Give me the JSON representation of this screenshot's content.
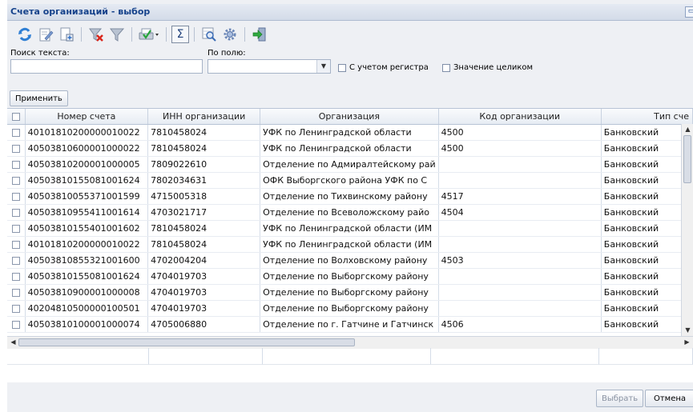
{
  "window": {
    "title": "Счета организаций - выбор"
  },
  "toolbar": {
    "buttons": [
      "refresh-icon",
      "edit-icon",
      "add-record-icon",
      "clear-filter-icon",
      "filter-icon",
      "print-icon",
      "sum-icon",
      "zoom-icon",
      "settings-icon",
      "exit-icon"
    ],
    "sum_label": "Σ"
  },
  "filter": {
    "search_label": "Поиск текста:",
    "search_value": "",
    "field_label": "По полю:",
    "field_value": "",
    "case_label": "С учетом регистра",
    "whole_label": "Значение целиком",
    "apply_label": "Применить"
  },
  "grid": {
    "columns": [
      "Номер счета",
      "ИНН организации",
      "Организация",
      "Код организации",
      "Тип сче"
    ],
    "rows": [
      [
        "40101810200000010022",
        "7810458024",
        "УФК по Ленинградской области",
        "4500",
        "Банковский"
      ],
      [
        "40503810600001000022",
        "7810458024",
        "УФК по Ленинградской области",
        "4500",
        "Банковский"
      ],
      [
        "40503810200001000005",
        "7809022610",
        "Отделение по Адмиралтейскому рай",
        "",
        "Банковский"
      ],
      [
        "40503810155081001624",
        "7802034631",
        "ОФК Выборгского района УФК по С",
        "",
        "Банковский"
      ],
      [
        "40503810055371001599",
        "4715005318",
        "Отделение по Тихвинскому району",
        "4517",
        "Банковский"
      ],
      [
        "40503810955411001614",
        "4703021717",
        "Отделение по Всеволожскому райо",
        "4504",
        "Банковский"
      ],
      [
        "40503810155401001602",
        "7810458024",
        "УФК по Ленинградской области (ИМ",
        "",
        "Банковский"
      ],
      [
        "40101810200000010022",
        "7810458024",
        "УФК по Ленинградской области (ИМ",
        "",
        "Банковский"
      ],
      [
        "40503810855321001600",
        "4702004204",
        "Отделение по Волховскому району",
        "4503",
        "Банковский"
      ],
      [
        "40503810155081001624",
        "4704019703",
        "Отделение по Выборгскому району",
        "",
        "Банковский"
      ],
      [
        "40503810900001000008",
        "4704019703",
        "Отделение по Выборгскому району",
        "",
        "Банковский"
      ],
      [
        "40204810500000100501",
        "4704019703",
        "Отделение по Выборгскому району",
        "",
        "Банковский"
      ],
      [
        "40503810100001000074",
        "4705006880",
        "Отделение по г. Гатчине и Гатчинск",
        "4506",
        "Банковский"
      ]
    ]
  },
  "actions": {
    "select_label": "Выбрать",
    "cancel_label": "Отмена"
  },
  "colors": {
    "title": "#15428b",
    "accent": "#3a78c2"
  }
}
